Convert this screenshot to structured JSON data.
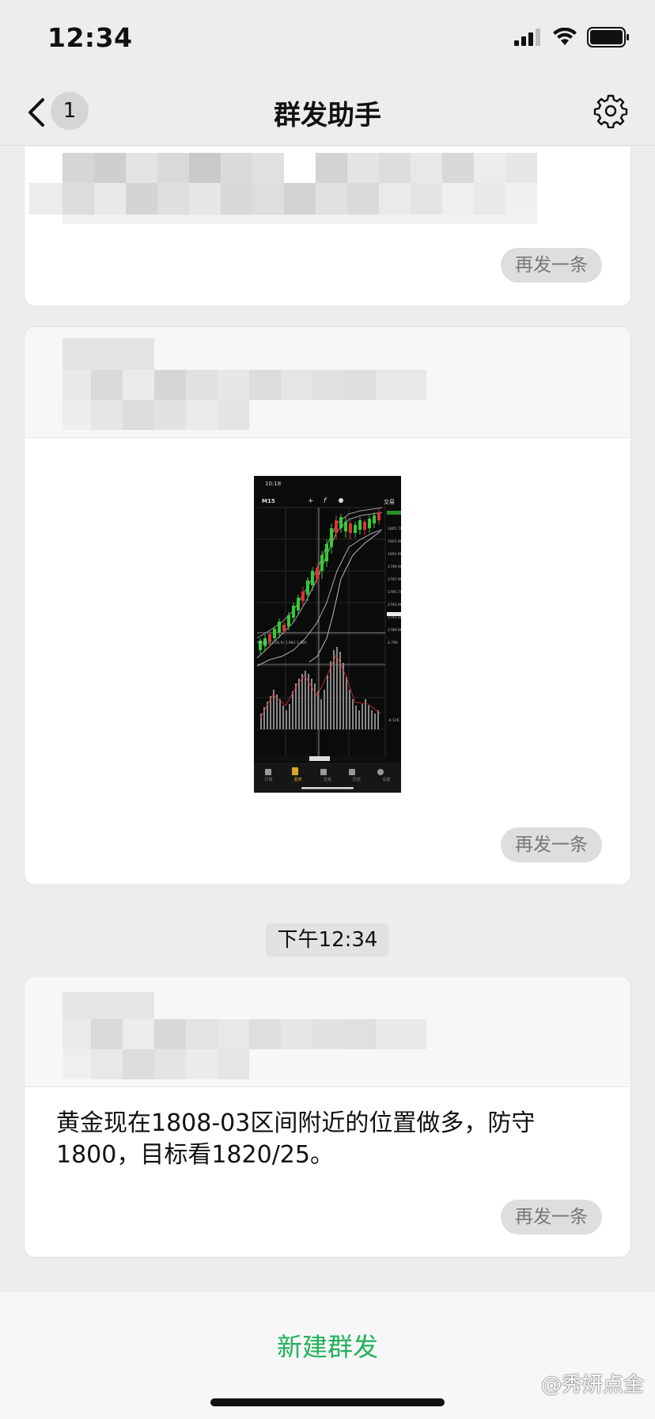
{
  "status_bar": {
    "time": "12:34"
  },
  "nav": {
    "back_count": "1",
    "title": "群发助手"
  },
  "cards": [
    {
      "resend_label": "再发一条"
    },
    {
      "resend_label": "再发一条",
      "thumbnail": {
        "time": "10:18",
        "timeframe": "M15",
        "trade_label": "交易",
        "tabs": [
          "行情",
          "图表",
          "交易",
          "历史",
          "设置"
        ]
      }
    },
    {
      "resend_label": "再发一条",
      "message": "黄金现在1808-03区间附近的位置做多，防守1800，目标看1820/25。"
    }
  ],
  "timestamp": "下午12:34",
  "bottom": {
    "new_broadcast_label": "新建群发",
    "watermark": "@秀妍点金"
  },
  "colors": {
    "accent_green": "#22b05a",
    "background": "#ededed"
  }
}
